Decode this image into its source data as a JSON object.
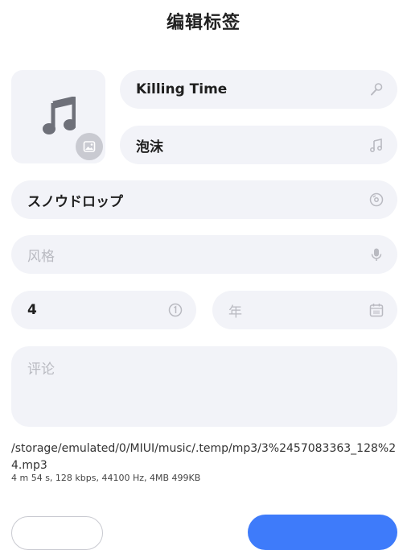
{
  "header": {
    "title": "编辑标签"
  },
  "fields": {
    "title_value": "Killing Time",
    "artist_value": "泡沫",
    "album_value": "スノウドロップ",
    "genre_placeholder": "风格",
    "track_value": "4",
    "year_placeholder": "年",
    "comment_placeholder": "评论"
  },
  "file": {
    "path": "/storage/emulated/0/MIUI/music/.temp/mp3/3%2457083363_128%24.mp3",
    "info": "4 m 54 s, 128 kbps, 44100 Hz, 4MB 499KB"
  },
  "icons": {
    "album_art": "music-note-icon",
    "change_art": "image-icon",
    "title": "microphone-icon",
    "artist": "music-note-icon",
    "album": "disc-icon",
    "genre": "microphone-icon",
    "track": "number-circle-icon",
    "year": "calendar-icon"
  },
  "colors": {
    "field_bg": "#f2f3f8",
    "placeholder": "#b9bac1",
    "primary_button": "#3e7bfa"
  }
}
